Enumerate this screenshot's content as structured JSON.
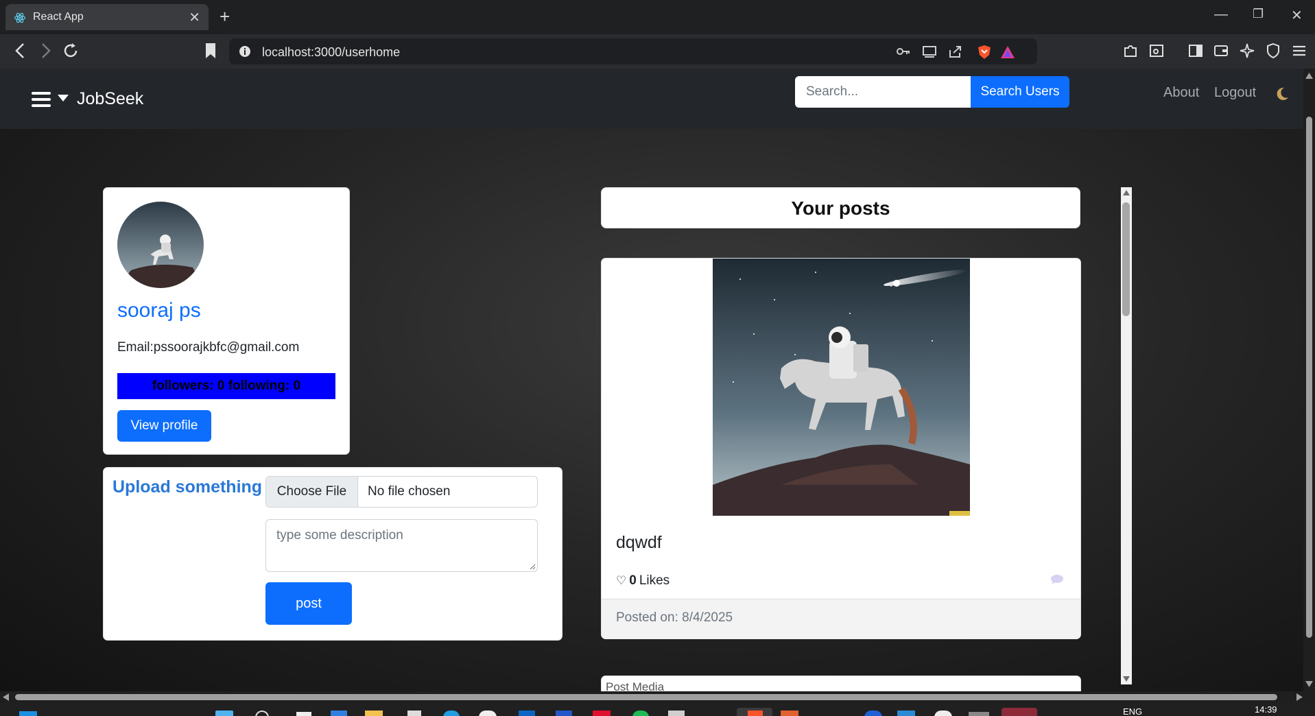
{
  "browser": {
    "tab_title": "React App",
    "url": "localhost:3000/userhome"
  },
  "navbar": {
    "brand": "JobSeek",
    "search_placeholder": "Search...",
    "search_button": "Search Users",
    "links": [
      "About",
      "Logout"
    ]
  },
  "profile": {
    "name": "sooraj ps",
    "email": "Email:pssoorajkbfc@gmail.com",
    "follow_stats": "followers: 0 following: 0",
    "view_profile_button": "View profile"
  },
  "upload": {
    "title": "Upload something",
    "file_button": "Choose File",
    "file_status": "No file chosen",
    "description_placeholder": "type some description",
    "post_button": "post"
  },
  "posts": {
    "header": "Your posts",
    "items": [
      {
        "title": "dqwdf",
        "likes_count": "0",
        "likes_label": "Likes",
        "posted_on": "Posted on: 8/4/2025"
      }
    ],
    "next_post_alt": "Post Media"
  },
  "taskbar": {
    "language": "ENG",
    "time": "14:39"
  }
}
